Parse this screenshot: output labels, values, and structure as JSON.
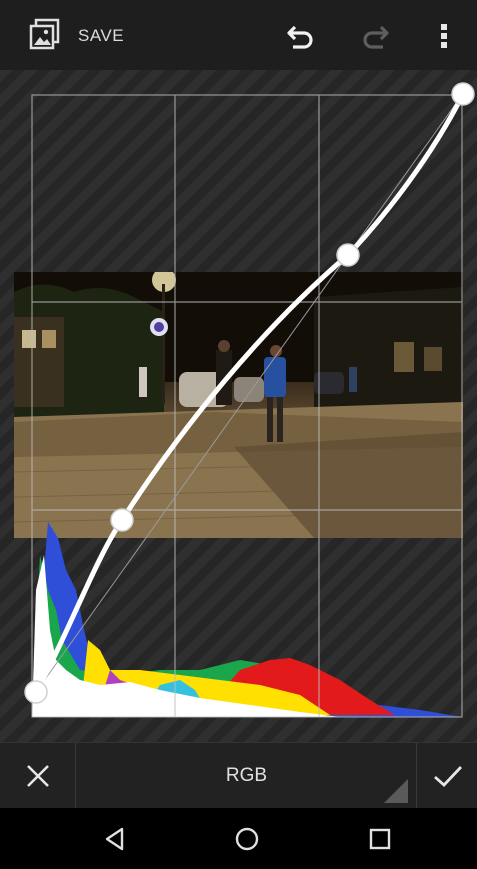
{
  "toolbar": {
    "save_label": "SAVE",
    "icons": {
      "save": "save-photo-icon",
      "undo": "undo-icon",
      "redo": "redo-icon",
      "more": "more-vert-icon"
    },
    "redo_enabled": false
  },
  "curve_editor": {
    "channel": "RGB",
    "grid_divisions": 3,
    "control_points": [
      {
        "input": 0,
        "output": 0
      },
      {
        "input": 0.21,
        "output": 0.34
      },
      {
        "input": 0.73,
        "output": 0.76
      },
      {
        "input": 1,
        "output": 1
      }
    ],
    "histogram_colors": [
      "#ffffff",
      "#2f4fd8",
      "#1aa64a",
      "#e31a1c",
      "#ffe000",
      "#b040c0",
      "#35c0e0"
    ]
  },
  "bottom_bar": {
    "channel_label": "RGB",
    "icons": {
      "cancel": "close-icon",
      "confirm": "check-icon",
      "dropdown": "dropdown-corner-icon"
    }
  },
  "nav_bar": {
    "icons": {
      "back": "back-triangle-icon",
      "home": "home-circle-icon",
      "recents": "recents-square-icon"
    }
  }
}
